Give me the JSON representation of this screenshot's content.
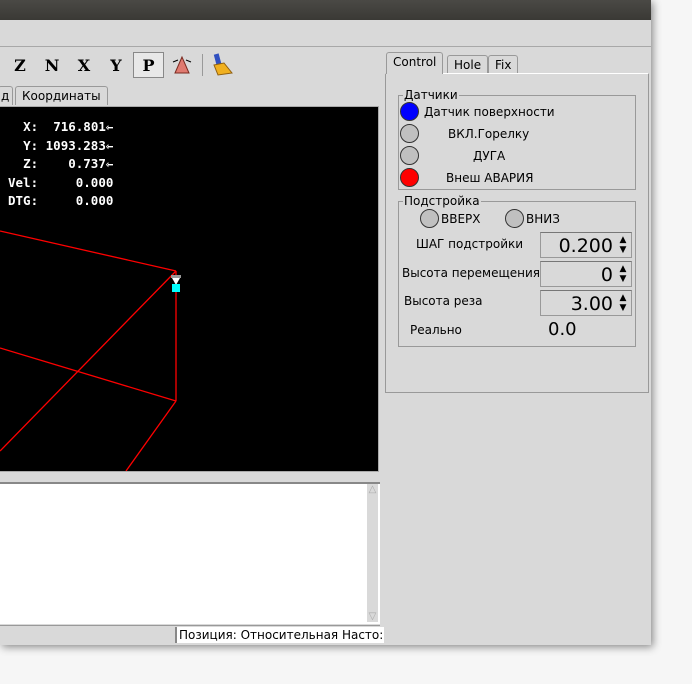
{
  "toolbar": {
    "buttons": [
      {
        "icon": "view-z-icon",
        "label": "Z"
      },
      {
        "icon": "view-z2-icon",
        "label": "N"
      },
      {
        "icon": "view-x-icon",
        "label": "X"
      },
      {
        "icon": "view-y-icon",
        "label": "Y"
      },
      {
        "icon": "view-p-icon",
        "label": "P"
      },
      {
        "icon": "rotate-view-icon"
      },
      {
        "icon": "clear-plot-icon"
      }
    ]
  },
  "left_tabs": [
    {
      "label": "д"
    },
    {
      "label": "Координаты"
    }
  ],
  "dro": {
    "lines": [
      {
        "axis": "X:",
        "value": "716.801",
        "homed": true
      },
      {
        "axis": "Y:",
        "value": "1093.283",
        "homed": true
      },
      {
        "axis": "Z:",
        "value": "0.737",
        "homed": true
      },
      {
        "axis": "Vel:",
        "value": "0.000"
      },
      {
        "axis": "DTG:",
        "value": "0.000"
      }
    ]
  },
  "right_tabs": [
    {
      "label": "Control",
      "active": true
    },
    {
      "label": "Hole"
    },
    {
      "label": "Fix"
    }
  ],
  "sensors": {
    "title": "Датчики",
    "items": [
      {
        "label": "Датчик поверхности",
        "color": "#0000ff"
      },
      {
        "label": "ВКЛ.Горелку",
        "color": "#c0c0c0"
      },
      {
        "label": "ДУГА",
        "color": "#c0c0c0"
      },
      {
        "label": "Внеш АВАРИЯ",
        "color": "#ff0000"
      }
    ]
  },
  "adjust": {
    "title": "Подстройка",
    "up": "ВВЕРХ",
    "down": "ВНИЗ",
    "step_label": "ШАГ подстройки",
    "step_value": "0.200",
    "travel_label": "Высота перемещения",
    "travel_value": "0",
    "cut_label": "Высота реза",
    "cut_value": "3.00",
    "actual_label": "Реально",
    "actual_value": "0.0"
  },
  "status": {
    "position": "Позиция: Относительная Насто:"
  },
  "colors": {
    "toolpath": "#ff0000",
    "background": "#000000"
  }
}
